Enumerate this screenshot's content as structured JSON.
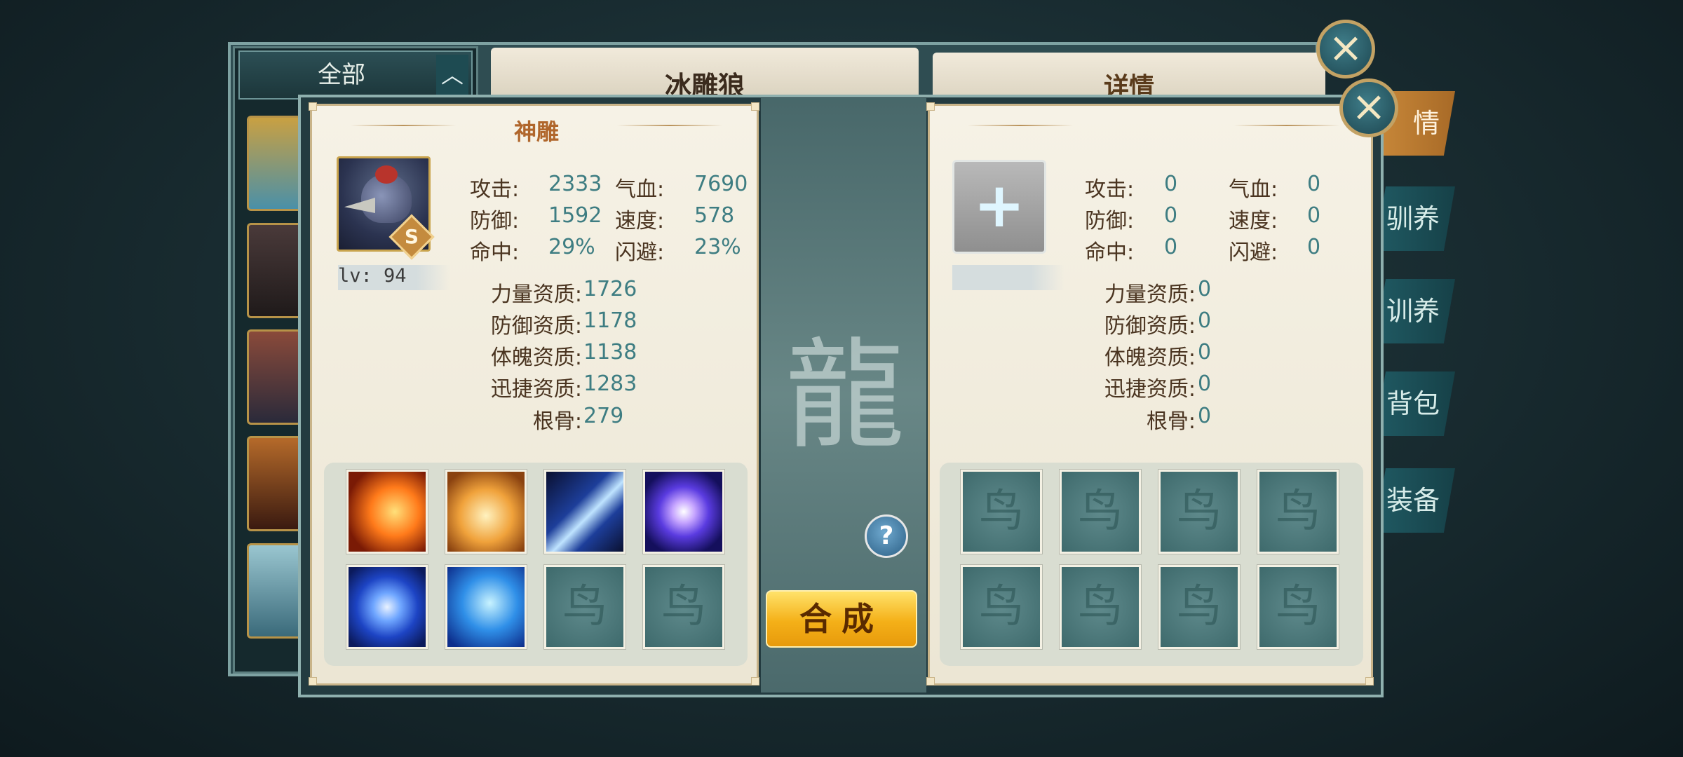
{
  "background": {
    "list_filter": "全部",
    "pet_name": "冰雕狼",
    "detail_title": "详情",
    "side_tabs": [
      "情",
      "驯养",
      "训养",
      "背包",
      "装备"
    ]
  },
  "left_panel": {
    "title": "神雕",
    "grade": "S",
    "level_text": "lv: 94",
    "stats": [
      {
        "label": "攻击:",
        "value": "2333"
      },
      {
        "label": "气血:",
        "value": "7690"
      },
      {
        "label": "防御:",
        "value": "1592"
      },
      {
        "label": "速度:",
        "value": "578"
      },
      {
        "label": "命中:",
        "value": "29%"
      },
      {
        "label": "闪避:",
        "value": "23%"
      }
    ],
    "aptitudes": [
      {
        "label": "力量资质:",
        "value": "1726"
      },
      {
        "label": "防御资质:",
        "value": "1178"
      },
      {
        "label": "体魄资质:",
        "value": "1138"
      },
      {
        "label": "迅捷资质:",
        "value": "1283"
      },
      {
        "label": "根骨:",
        "value": "279"
      }
    ],
    "skills": [
      "fire-phoenix-icon",
      "flame-lion-icon",
      "ice-claw-icon",
      "void-orb-icon",
      "vortex-icon",
      "frost-beast-icon",
      "empty",
      "empty"
    ]
  },
  "right_panel": {
    "title": "",
    "add_symbol": "+",
    "stats": [
      {
        "label": "攻击:",
        "value": "0"
      },
      {
        "label": "气血:",
        "value": "0"
      },
      {
        "label": "防御:",
        "value": "0"
      },
      {
        "label": "速度:",
        "value": "0"
      },
      {
        "label": "命中:",
        "value": "0"
      },
      {
        "label": "闪避:",
        "value": "0"
      }
    ],
    "aptitudes": [
      {
        "label": "力量资质:",
        "value": "0"
      },
      {
        "label": "防御资质:",
        "value": "0"
      },
      {
        "label": "体魄资质:",
        "value": "0"
      },
      {
        "label": "迅捷资质:",
        "value": "0"
      },
      {
        "label": "根骨:",
        "value": "0"
      }
    ]
  },
  "middle": {
    "help_label": "?",
    "merge_label": "合成"
  },
  "icons": {
    "close": "×",
    "empty_slot": "鸟"
  },
  "colors": {
    "label": "#4a3420",
    "value": "#3e7d82",
    "title": "#b0662b",
    "button": "#f4b018"
  }
}
